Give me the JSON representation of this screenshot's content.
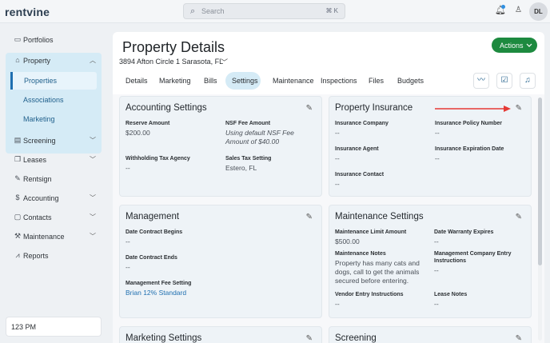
{
  "app": {
    "logo_text": "rentvine"
  },
  "topbar": {
    "search_placeholder": "Search",
    "search_shortcut": "⌘ K",
    "avatar_initials": "DL"
  },
  "sidebar": {
    "items": [
      {
        "label": "Portfolios",
        "icon": "folder-icon"
      },
      {
        "label": "Property",
        "icon": "building-icon"
      },
      {
        "label": "Screening",
        "icon": "document-search-icon"
      },
      {
        "label": "Leases",
        "icon": "file-copy-icon"
      },
      {
        "label": "Rentsign",
        "icon": "signature-icon"
      },
      {
        "label": "Accounting",
        "icon": "dollar-icon"
      },
      {
        "label": "Contacts",
        "icon": "contact-card-icon"
      },
      {
        "label": "Maintenance",
        "icon": "hammer-icon"
      },
      {
        "label": "Reports",
        "icon": "chart-icon"
      }
    ],
    "property_subitems": [
      "Properties",
      "Associations",
      "Marketing"
    ],
    "time": "123 PM"
  },
  "header": {
    "title": "Property Details",
    "address": "3894 Afton Circle 1 Sarasota, FL",
    "actions_label": "Actions"
  },
  "tabs": [
    "Details",
    "Marketing",
    "Bills",
    "Settings",
    "Maintenance",
    "Inspections",
    "Files",
    "Budgets"
  ],
  "active_tab": "Settings",
  "cards": {
    "accounting": {
      "title": "Accounting Settings",
      "fields": [
        {
          "label": "Reserve Amount",
          "value": "$200.00"
        },
        {
          "label": "NSF Fee Amount",
          "value": "Using default NSF Fee Amount of $40.00"
        },
        {
          "label": "Withholding Tax Agency",
          "value": "--"
        },
        {
          "label": "Sales Tax Setting",
          "value": "Estero, FL"
        }
      ]
    },
    "insurance": {
      "title": "Property Insurance",
      "fields": [
        {
          "label": "Insurance Company",
          "value": "--"
        },
        {
          "label": "Insurance Policy Number",
          "value": "--"
        },
        {
          "label": "Insurance Agent",
          "value": "--"
        },
        {
          "label": "Insurance Expiration Date",
          "value": "--"
        },
        {
          "label": "Insurance Contact",
          "value": "--"
        }
      ]
    },
    "management": {
      "title": "Management",
      "fields": [
        {
          "label": "Date Contract Begins",
          "value": "--"
        },
        {
          "label": "Date Contract Ends",
          "value": "--"
        },
        {
          "label": "Management Fee Setting",
          "value": "Brian 12% Standard"
        }
      ]
    },
    "maintenance": {
      "title": "Maintenance Settings",
      "fields": [
        {
          "label": "Maintenance Limit Amount",
          "value": "$500.00"
        },
        {
          "label": "Date Warranty Expires",
          "value": "--"
        },
        {
          "label": "Maintenance Notes",
          "value": "Property has many cats and dogs, call to get the animals secured before entering."
        },
        {
          "label": "Management Company Entry Instructions",
          "value": "--"
        },
        {
          "label": "Vendor Entry Instructions",
          "value": "--"
        },
        {
          "label": "Lease Notes",
          "value": "--"
        }
      ]
    },
    "marketing": {
      "title": "Marketing Settings"
    },
    "screening": {
      "title": "Screening"
    }
  },
  "colors": {
    "accent": "#1f6fb0",
    "actions_green": "#1d8a3f",
    "nav_active_bg": "#d5ebf6",
    "annotation_arrow": "#e53935"
  }
}
